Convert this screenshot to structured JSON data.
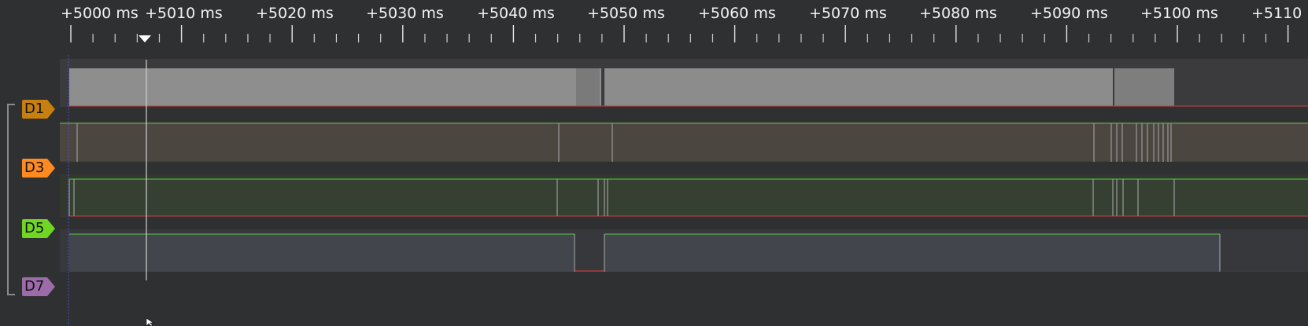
{
  "ruler": {
    "tick_labels": [
      "+5000 ms",
      "+5010 ms",
      "+5020 ms",
      "+5030 ms",
      "+5040 ms",
      "+5050 ms",
      "+5060 ms",
      "+5070 ms",
      "+5080 ms",
      "+5090 ms",
      "+5100 ms",
      "+5110 ms"
    ]
  },
  "channels": [
    {
      "label": "D1",
      "color": "#d38a1a"
    },
    {
      "label": "D3",
      "color": "#ff8a1f"
    },
    {
      "label": "D5",
      "color": "#6fd624"
    },
    {
      "label": "D7",
      "color": "#9b6ca8"
    }
  ],
  "colors": {
    "background": "#2f3032",
    "high_line": "#58c84a",
    "low_line": "#c83a3a",
    "edge": "#9a9a9a",
    "cursor": "#d0d0d0",
    "trigger_marker": "#ffffff"
  },
  "icons": {
    "trigger_marker": "triangle-down-icon",
    "mouse_cursor": "mouse-pointer-icon"
  }
}
